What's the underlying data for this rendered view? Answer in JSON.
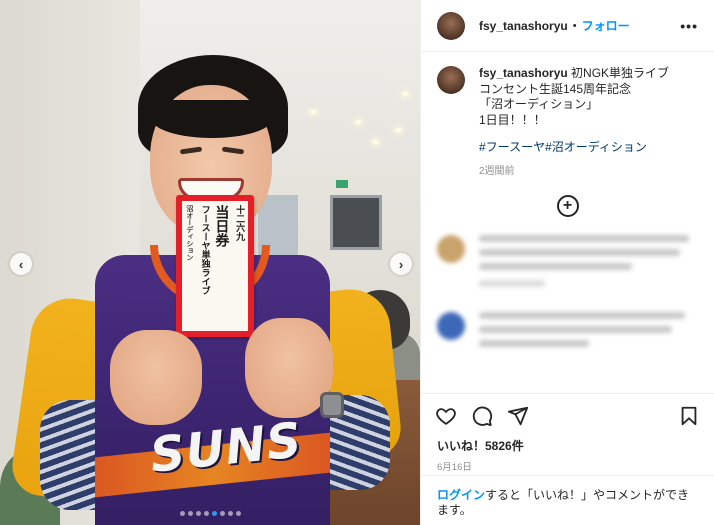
{
  "post": {
    "photo": {
      "jersey_text": "SUNS",
      "card_text": {
        "col1": "十二六九",
        "col2": "当日券",
        "col3": "フースーヤ単独ライブ",
        "col4": "沼オーディション"
      },
      "carousel": {
        "dot_count": 8,
        "active_dot": 4
      }
    },
    "header": {
      "username": "fsy_tanashoryu",
      "separator": "•",
      "follow_label": "フォロー",
      "more_icon": "more-horizontal-icon"
    },
    "caption": {
      "username": "fsy_tanashoryu",
      "line1": "初NGK単独ライブ",
      "line2": "コンセント生誕145周年記念",
      "line3": "「沼オーディション」",
      "line4": "1日目！！！",
      "hashtag1": "#フースーヤ",
      "hashtag2": "#沼オーディション",
      "time": "2週間前"
    },
    "load_more_icon": "plus-circle-icon",
    "actions": {
      "like_icon": "heart-icon",
      "comment_icon": "comment-icon",
      "share_icon": "send-icon",
      "save_icon": "bookmark-icon"
    },
    "likes": "いいね！5826件",
    "date": "6月16日",
    "login": {
      "link": "ログイン",
      "text": "すると「いいね！」やコメントができます。"
    },
    "colors": {
      "accent": "#0095f6",
      "hashtag": "#00376b",
      "muted": "#8e8e8e",
      "card_red": "#e3202a",
      "jersey_purple": "#4b2e83",
      "jersey_orange": "#e35a1e"
    }
  }
}
